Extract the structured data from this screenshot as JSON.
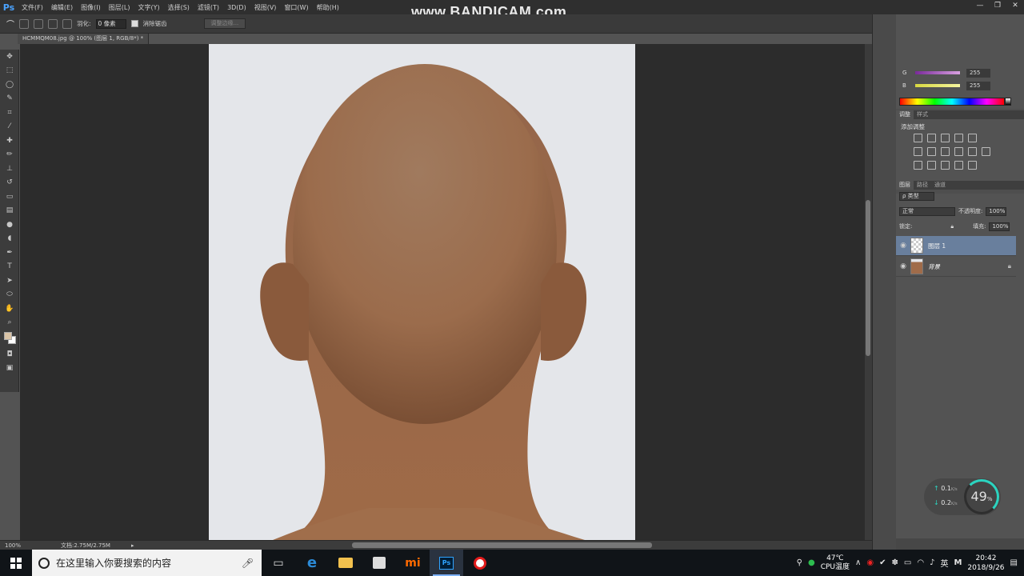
{
  "app": {
    "logo": "Ps",
    "watermark": "www.BANDICAM.com"
  },
  "menu": [
    "文件(F)",
    "编辑(E)",
    "图像(I)",
    "图层(L)",
    "文字(Y)",
    "选择(S)",
    "滤镜(T)",
    "3D(D)",
    "视图(V)",
    "窗口(W)",
    "帮助(H)"
  ],
  "window_controls": {
    "minimize": "—",
    "restore": "❐",
    "close": "✕"
  },
  "options": {
    "feather_label": "羽化:",
    "feather_value": "0 像素",
    "antialias_label": "消除锯齿",
    "refine_button": "调整边缘..."
  },
  "document": {
    "tab_title": "HCMMQM08.jpg @ 100% (图层 1, RGB/8*) *",
    "zoom": "100%",
    "doc_size": "文档:2.75M/2.75M"
  },
  "color_panel": {
    "g_label": "G",
    "g_value": "255",
    "b_label": "B",
    "b_value": "255",
    "g_color": "#d8a0e0",
    "b_color": "#e8e840"
  },
  "adjust_panel": {
    "tabs": [
      "调整",
      "样式"
    ],
    "title": "添加调整"
  },
  "layers_panel": {
    "tabs": [
      "图层",
      "路径",
      "通道"
    ],
    "filter_label": "ρ 类型",
    "blend_mode": "正常",
    "opacity_label": "不透明度:",
    "opacity_value": "100%",
    "lock_label": "锁定:",
    "fill_label": "填充:",
    "fill_value": "100%",
    "layers": [
      {
        "name": "图层 1",
        "selected": true
      },
      {
        "name": "背景",
        "selected": false
      }
    ]
  },
  "net_widget": {
    "upload": "0.1",
    "download": "0.2",
    "unit": "K/s",
    "cpu_percent": "49",
    "cpu_symbol": "%"
  },
  "taskbar": {
    "search_placeholder": "在这里输入你要搜索的内容",
    "cpu_temp": "47℃",
    "cpu_label": "CPU温度",
    "ime": "英",
    "ime_mode": "M",
    "time": "20:42",
    "date": "2018/9/26"
  }
}
